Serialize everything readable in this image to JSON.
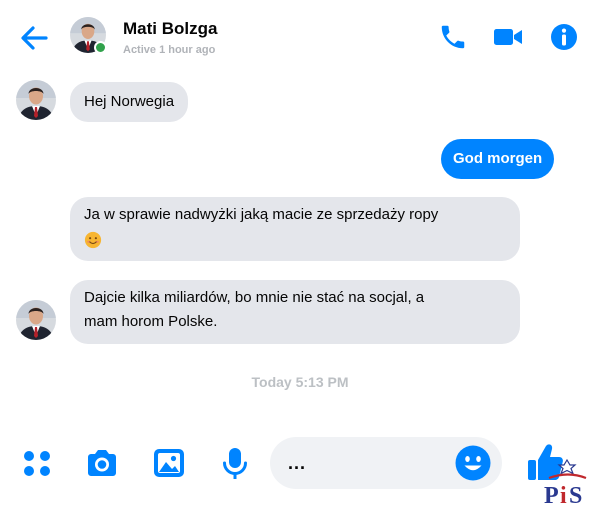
{
  "header": {
    "name": "Mati Bolzga",
    "status": "Active 1 hour ago"
  },
  "messages": [
    {
      "direction": "incoming",
      "text": "Hej Norwegia"
    },
    {
      "direction": "outgoing",
      "text": "God morgen"
    },
    {
      "direction": "incoming",
      "text": "Ja w sprawie nadwyżki jaką macie ze sprzedaży ropy"
    },
    {
      "direction": "incoming",
      "line1": "Dajcie kilka miliardów, bo mnie nie stać na socjal, a",
      "line2": "mam horom Polske."
    }
  ],
  "timestamp": "Today 5:13 PM",
  "composer": {
    "placeholder": "..."
  },
  "watermark": "PiS",
  "colors": {
    "accent": "#0084ff",
    "incoming_bubble": "#e4e6eb",
    "online": "#31a24c",
    "muted": "#b0b3b8"
  },
  "icons": [
    "back-arrow-icon",
    "phone-icon",
    "video-camera-icon",
    "info-icon",
    "apps-grid-icon",
    "camera-icon",
    "image-icon",
    "microphone-icon",
    "smiley-icon",
    "thumbs-up-icon"
  ]
}
